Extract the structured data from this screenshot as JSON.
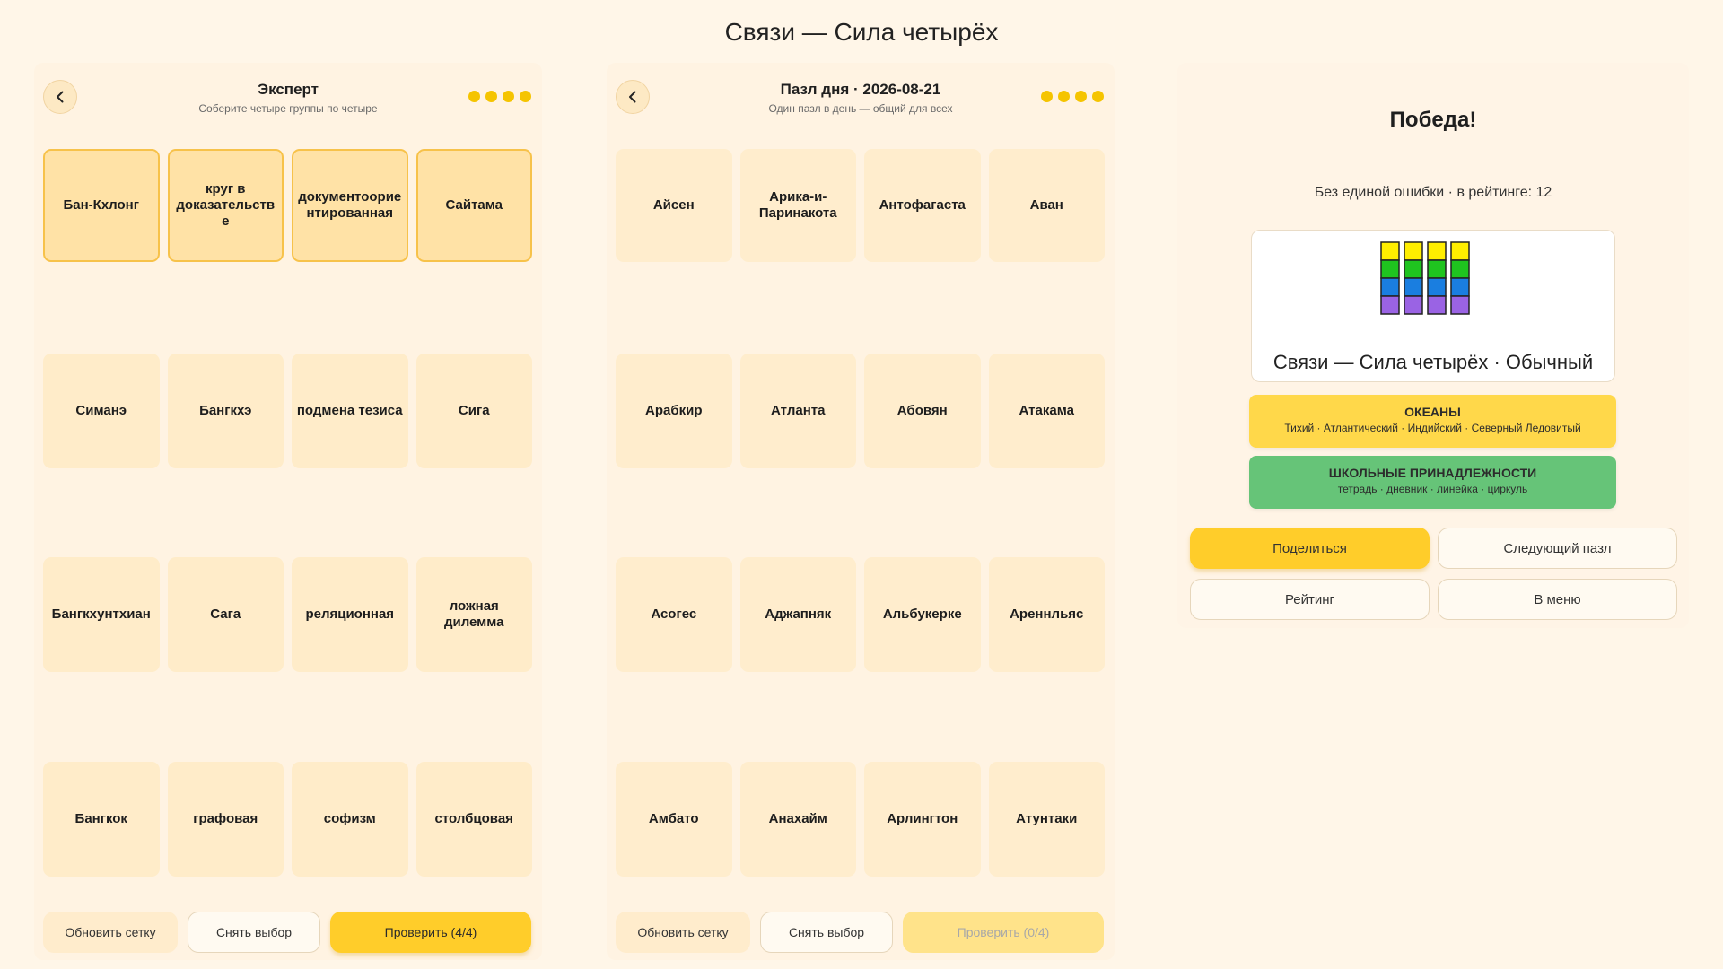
{
  "app": {
    "title": "Связи — Сила четырёх"
  },
  "expert": {
    "title": "Эксперт",
    "subtitle": "Соберите четыре группы по четыре",
    "lives": 4,
    "tiles": [
      {
        "label": "Бан-Кхлонг",
        "selected": true
      },
      {
        "label": "круг в доказательстве",
        "selected": true
      },
      {
        "label": "документоориентированная",
        "selected": true
      },
      {
        "label": "Сайтама",
        "selected": true
      },
      {
        "label": "Симанэ",
        "selected": false
      },
      {
        "label": "Бангкхэ",
        "selected": false
      },
      {
        "label": "подмена тезиса",
        "selected": false
      },
      {
        "label": "Сига",
        "selected": false
      },
      {
        "label": "Бангкхунтхиан",
        "selected": false
      },
      {
        "label": "Сага",
        "selected": false
      },
      {
        "label": "реляционная",
        "selected": false
      },
      {
        "label": "ложная дилемма",
        "selected": false
      },
      {
        "label": "Бангкок",
        "selected": false
      },
      {
        "label": "графовая",
        "selected": false
      },
      {
        "label": "софизм",
        "selected": false
      },
      {
        "label": "столбцовая",
        "selected": false
      }
    ],
    "buttons": {
      "refresh": "Обновить сетку",
      "clear": "Снять выбор",
      "check": "Проверить (4/4)"
    }
  },
  "daily": {
    "title": "Пазл дня · 2026-08-21",
    "subtitle": "Один пазл в день — общий для всех",
    "lives": 4,
    "tiles": [
      {
        "label": "Айсен"
      },
      {
        "label": "Арика-и-Паринакота"
      },
      {
        "label": "Антофагаста"
      },
      {
        "label": "Аван"
      },
      {
        "label": "Арабкир"
      },
      {
        "label": "Атланта"
      },
      {
        "label": "Абовян"
      },
      {
        "label": "Атакама"
      },
      {
        "label": "Асогес"
      },
      {
        "label": "Аджапняк"
      },
      {
        "label": "Альбукерке"
      },
      {
        "label": "Ареннльяс"
      },
      {
        "label": "Амбато"
      },
      {
        "label": "Анахайм"
      },
      {
        "label": "Арлингтон"
      },
      {
        "label": "Атунтаки"
      }
    ],
    "buttons": {
      "refresh": "Обновить сетку",
      "clear": "Снять выбор",
      "check": "Проверить (0/4)"
    }
  },
  "result": {
    "title": "Победа!",
    "stats": "Без единой ошибки · в рейтинге: 12",
    "share_caption": "Связи — Сила четырёх · Обычный",
    "share_grid_colors": [
      "#ffee00",
      "#1fc41f",
      "#1a7ee0",
      "#9a63e4"
    ],
    "groups": [
      {
        "name": "ОКЕАНЫ",
        "words": "Тихий · Атлантический · Индийский · Северный Ледовитый",
        "color": "#ffd84a"
      },
      {
        "name": "ШКОЛЬНЫЕ ПРИНАДЛЕЖНОСТИ",
        "words": "тетрадь · дневник · линейка · циркуль",
        "color": "#66c478"
      }
    ],
    "buttons": {
      "share": "Поделиться",
      "next": "Следующий пазл",
      "rating": "Рейтинг",
      "menu": "В меню"
    }
  }
}
